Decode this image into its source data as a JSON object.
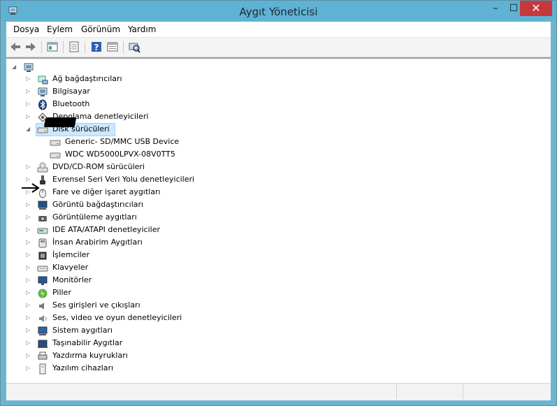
{
  "window": {
    "title": "Aygıt Yöneticisi",
    "controls": {
      "minimize": "–",
      "maximize": "☐",
      "close": "✕"
    }
  },
  "menu": [
    "Dosya",
    "Eylem",
    "Görünüm",
    "Yardım"
  ],
  "toolbar": [
    "back-icon",
    "forward-icon",
    "show-hide-tree-icon",
    "properties-icon",
    "help-icon",
    "view-icon",
    "scan-hardware-icon"
  ],
  "tree": {
    "root": {
      "label": "",
      "icon": "computer-icon"
    },
    "items": [
      {
        "label": "Ağ bağdaştırıcıları",
        "icon": "network-adapter-icon",
        "expanded": false
      },
      {
        "label": "Bilgisayar",
        "icon": "computer-icon",
        "expanded": false
      },
      {
        "label": "Bluetooth",
        "icon": "bluetooth-icon",
        "expanded": false
      },
      {
        "label": "Depolama denetleyicileri",
        "icon": "storage-controller-icon",
        "expanded": false
      },
      {
        "label": "Disk sürücüleri",
        "icon": "disk-drive-icon",
        "expanded": true,
        "selected": true,
        "children": [
          "Generic- SD/MMC USB Device",
          "WDC WD5000LPVX-08V0TT5"
        ]
      },
      {
        "label": "DVD/CD-ROM sürücüleri",
        "icon": "dvd-drive-icon",
        "expanded": false
      },
      {
        "label": "Evrensel Seri Veri Yolu denetleyicileri",
        "icon": "usb-icon",
        "expanded": false
      },
      {
        "label": "Fare ve diğer işaret aygıtları",
        "icon": "mouse-icon",
        "expanded": false
      },
      {
        "label": "Görüntü bağdaştırıcıları",
        "icon": "display-adapter-icon",
        "expanded": false
      },
      {
        "label": "Görüntüleme aygıtları",
        "icon": "camera-icon",
        "expanded": false
      },
      {
        "label": "IDE ATA/ATAPI denetleyiciler",
        "icon": "ide-controller-icon",
        "expanded": false
      },
      {
        "label": "İnsan Arabirim Aygıtları",
        "icon": "hid-icon",
        "expanded": false
      },
      {
        "label": "İşlemciler",
        "icon": "processor-icon",
        "expanded": false
      },
      {
        "label": "Klavyeler",
        "icon": "keyboard-icon",
        "expanded": false
      },
      {
        "label": "Monitörler",
        "icon": "monitor-icon",
        "expanded": false
      },
      {
        "label": "Piller",
        "icon": "battery-icon",
        "expanded": false
      },
      {
        "label": "Ses girişleri ve çıkışları",
        "icon": "audio-io-icon",
        "expanded": false
      },
      {
        "label": "Ses, video ve oyun denetleyicileri",
        "icon": "sound-icon",
        "expanded": false
      },
      {
        "label": "Sistem aygıtları",
        "icon": "system-device-icon",
        "expanded": false
      },
      {
        "label": "Taşınabilir Aygıtlar",
        "icon": "portable-device-icon",
        "expanded": false
      },
      {
        "label": "Yazdırma kuyrukları",
        "icon": "printer-icon",
        "expanded": false
      },
      {
        "label": "Yazılım cihazları",
        "icon": "software-device-icon",
        "expanded": false
      }
    ]
  },
  "colors": {
    "titlebar": "#5fb2d3",
    "close": "#c7383c",
    "selection": "#cce8ff"
  }
}
